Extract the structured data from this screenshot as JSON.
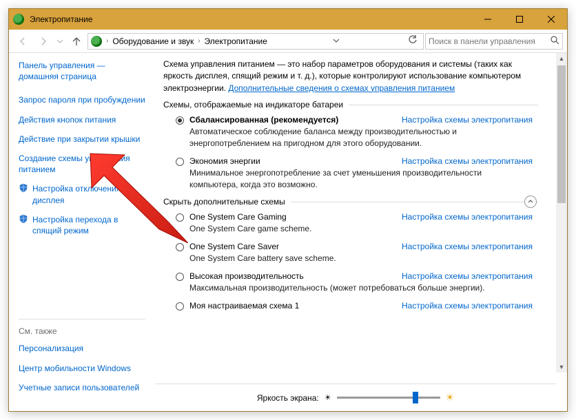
{
  "window": {
    "title": "Электропитание"
  },
  "breadcrumb": {
    "cat": "Оборудование и звук",
    "page": "Электропитание"
  },
  "search": {
    "placeholder": "Поиск в панели управления"
  },
  "sidebar": {
    "home": "Панель управления — домашняя страница",
    "links": [
      "Запрос пароля при пробуждении",
      "Действия кнопок питания",
      "Действие при закрытии крышки",
      "Создание схемы управления питанием"
    ],
    "icon_links": [
      "Настройка отключения дисплея",
      "Настройка перехода в спящий режим"
    ],
    "see_also_heading": "См. также",
    "see_also": [
      "Персонализация",
      "Центр мобильности Windows",
      "Учетные записи пользователей"
    ]
  },
  "main": {
    "intro": "Схема управления питанием — это набор параметров оборудования и системы (таких как яркость дисплея, спящий режим и т. д.), которые контролируют использование компьютером электроэнергии.",
    "intro_link": "Дополнительные сведения о схемах управления питанием",
    "group1": "Схемы, отображаемые на индикаторе батареи",
    "group2": "Скрыть дополнительные схемы",
    "action_label": "Настройка схемы электропитания",
    "plans1": [
      {
        "name": "Сбалансированная (рекомендуется)",
        "desc": "Автоматическое соблюдение баланса между производительностью и энергопотреблением на пригодном для этого оборудовании.",
        "checked": true,
        "bold": true
      },
      {
        "name": "Экономия энергии",
        "desc": "Минимальное энергопотребление за счет уменьшения производительности компьютера, когда это возможно.",
        "checked": false,
        "bold": false
      }
    ],
    "plans2": [
      {
        "name": "One System Care Gaming",
        "desc": "One System Care game scheme.",
        "checked": false
      },
      {
        "name": "One System Care Saver",
        "desc": "One System Care battery save scheme.",
        "checked": false
      },
      {
        "name": "Высокая производительность",
        "desc": "Максимальная производительность (может потребоваться больше энергии).",
        "checked": false
      },
      {
        "name": "Моя настраиваемая схема 1",
        "desc": "",
        "checked": false
      }
    ],
    "brightness_label": "Яркость экрана:"
  }
}
